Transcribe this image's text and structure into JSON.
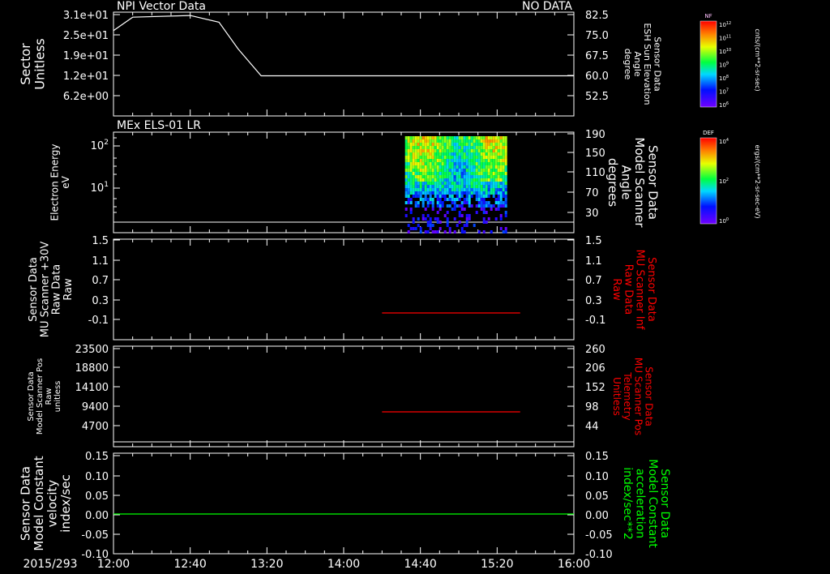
{
  "date_label": "2015/293",
  "x_ticks": [
    "12:00",
    "12:40",
    "13:20",
    "14:00",
    "14:40",
    "15:20",
    "16:00"
  ],
  "colors": {
    "background": "#000000",
    "axis": "#ffffff",
    "red_series": "#ff0000",
    "green_series": "#00ff00"
  },
  "chart_data": [
    {
      "type": "line",
      "title": "NPI Vector Data",
      "status": "NO DATA",
      "ylabel": "Sector\nUnitless",
      "y_ticks": [
        "3.1e+01",
        "2.5e+01",
        "1.9e+01",
        "1.2e+01",
        "6.2e+00"
      ],
      "y2label": "Sensor Data\nESH Sun Elevation\nAngle\ndegree",
      "y2_ticks": [
        "82.5",
        "75.0",
        "67.5",
        "60.0",
        "52.5"
      ],
      "ylim": [
        0,
        31
      ],
      "y2lim": [
        45,
        82.5
      ],
      "x": [
        "12:00",
        "12:10",
        "12:40",
        "12:55",
        "13:05",
        "13:17",
        "16:00"
      ],
      "values": [
        25.5,
        29.5,
        30.0,
        28.0,
        20.0,
        12.0,
        12.0
      ]
    },
    {
      "type": "heatmap",
      "title": "MEx ELS-01 LR",
      "ylabel": "Electron Energy\neV",
      "y_ticks": [
        "10^2",
        "10^1"
      ],
      "y2label": "Sensor Data\nModel Scanner\nAngle\ndegrees",
      "y2_ticks": [
        "190",
        "150",
        "110",
        "70",
        "30"
      ],
      "x_range": [
        "14:32",
        "15:24"
      ],
      "baseline": "flat line near bottom",
      "colorbar": {
        "label": "DEF",
        "units": "ergs/(cm**2-sr-sec-eV)",
        "ticks": [
          "10^4",
          "10^2",
          "10^0"
        ]
      }
    },
    {
      "type": "line",
      "ylabel": "Sensor Data\nMU Scanner +30V\nRaw Data\nRaw",
      "y_ticks": [
        "1.5",
        "1.1",
        "0.7",
        "0.3",
        "-0.1"
      ],
      "y2label": "Sensor Data\nMU Scanner Inf\nRaw Data\nRaw",
      "y2_ticks": [
        "1.5",
        "1.1",
        "0.7",
        "0.3",
        "-0.1"
      ],
      "ylim": [
        -0.5,
        1.5
      ],
      "series": [
        {
          "color": "red",
          "x": [
            "14:20",
            "15:32"
          ],
          "values": [
            -0.05,
            -0.05
          ]
        }
      ]
    },
    {
      "type": "line",
      "ylabel": "Sensor Data\nModel Scanner Pos\nRaw\nunitless",
      "y_ticks": [
        "23500",
        "18800",
        "14100",
        "9400",
        "4700"
      ],
      "y2label": "Sensor Data\nMU Scanner Pos\nTelemetry\nUnitless",
      "y2_ticks": [
        "260",
        "206",
        "152",
        "98",
        "44"
      ],
      "ylim": [
        0,
        23500
      ],
      "series": [
        {
          "color": "red",
          "x": [
            "14:20",
            "15:32"
          ],
          "values": [
            8000,
            8000
          ]
        }
      ]
    },
    {
      "type": "line",
      "ylabel": "Sensor Data\nModel Constant\nvelocity\nindex/sec",
      "y_ticks": [
        "0.15",
        "0.10",
        "0.05",
        "0.00",
        "-0.05",
        "-0.10"
      ],
      "y2label": "Sensor Data\nModel Constant\nacceleration\nindex/sec**2",
      "y2_ticks": [
        "0.15",
        "0.10",
        "0.05",
        "0.00",
        "-0.05",
        "-0.10"
      ],
      "ylim": [
        -0.1,
        0.15
      ],
      "series": [
        {
          "color": "green",
          "x": [
            "12:00",
            "16:00"
          ],
          "values": [
            0,
            0
          ]
        }
      ]
    }
  ],
  "colorbars": [
    {
      "label": "NF",
      "units": "cnts/(cm**2-sr-sec)",
      "ticks": [
        "10^12",
        "10^11",
        "10^10",
        "10^9",
        "10^8",
        "10^7",
        "10^6"
      ]
    },
    {
      "label": "DEF",
      "units": "ergs/(cm**2-sr-sec-eV)",
      "ticks": [
        "10^4",
        "10^2",
        "10^0"
      ]
    }
  ]
}
